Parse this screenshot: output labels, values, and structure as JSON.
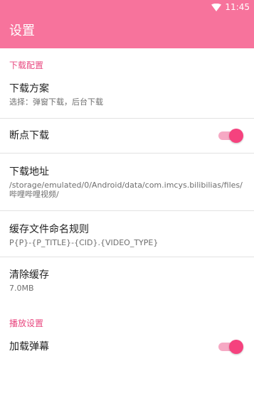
{
  "status_bar": {
    "time": "11:45"
  },
  "app_bar": {
    "title": "设置"
  },
  "categories": {
    "download": "下载配置",
    "playback": "播放设置"
  },
  "prefs": {
    "download_plan": {
      "title": "下载方案",
      "summary": "选择：弹窗下载，后台下载"
    },
    "resume_download": {
      "title": "断点下载",
      "enabled": true
    },
    "download_path": {
      "title": "下载地址",
      "summary": "/storage/emulated/0/Android/data/com.imcys.bilibilias/files/哔哩哔哩视频/"
    },
    "cache_naming": {
      "title": "缓存文件命名规则",
      "summary": "P{P}-{P_TITLE}-{CID}.{VIDEO_TYPE}"
    },
    "clear_cache": {
      "title": "清除缓存",
      "summary": "7.0MB"
    },
    "load_danmaku": {
      "title": "加载弹幕",
      "enabled": true
    }
  },
  "colors": {
    "primary": "#f7739c",
    "accent": "#f5427e",
    "category_text": "#e8477f"
  },
  "icons": {
    "status_wifi": "wifi-icon"
  }
}
